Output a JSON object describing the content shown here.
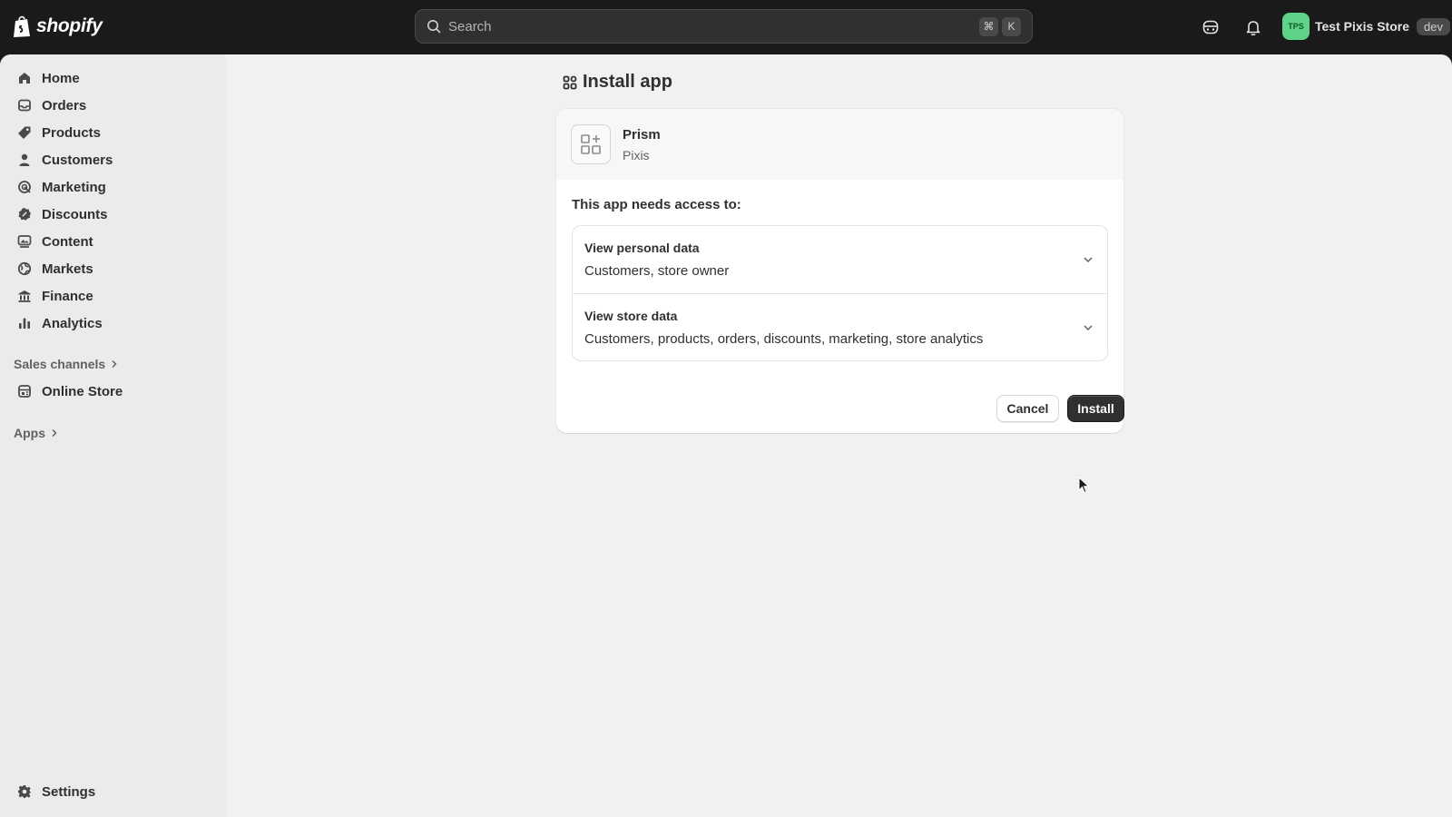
{
  "topbar": {
    "brand": "shopify",
    "search_placeholder": "Search",
    "shortcut_cmd": "⌘",
    "shortcut_key": "K",
    "store_initials": "TPS",
    "store_name": "Test Pixis Store",
    "store_badge": "dev"
  },
  "sidebar": {
    "items": [
      {
        "label": "Home",
        "icon": "home-icon"
      },
      {
        "label": "Orders",
        "icon": "inbox-icon"
      },
      {
        "label": "Products",
        "icon": "tag-icon"
      },
      {
        "label": "Customers",
        "icon": "person-icon"
      },
      {
        "label": "Marketing",
        "icon": "target-icon"
      },
      {
        "label": "Discounts",
        "icon": "discount-icon"
      },
      {
        "label": "Content",
        "icon": "image-icon"
      },
      {
        "label": "Markets",
        "icon": "globe-icon"
      },
      {
        "label": "Finance",
        "icon": "bank-icon"
      },
      {
        "label": "Analytics",
        "icon": "bar-chart-icon"
      }
    ],
    "sales_channels_label": "Sales channels",
    "online_store_label": "Online Store",
    "apps_label": "Apps",
    "settings_label": "Settings"
  },
  "main": {
    "title": "Install app",
    "app_name": "Prism",
    "app_developer": "Pixis",
    "access_heading": "This app needs access to:",
    "permissions": [
      {
        "title": "View personal data",
        "detail": "Customers, store owner"
      },
      {
        "title": "View store data",
        "detail": "Customers, products, orders, discounts, marketing, store analytics"
      }
    ],
    "cancel_label": "Cancel",
    "install_label": "Install"
  },
  "colors": {
    "topbar": "#1a1a1a",
    "sidebar": "#ebebeb",
    "canvas": "#f1f1f1",
    "avatar": "#5fd388",
    "primary_button": "#303030"
  }
}
